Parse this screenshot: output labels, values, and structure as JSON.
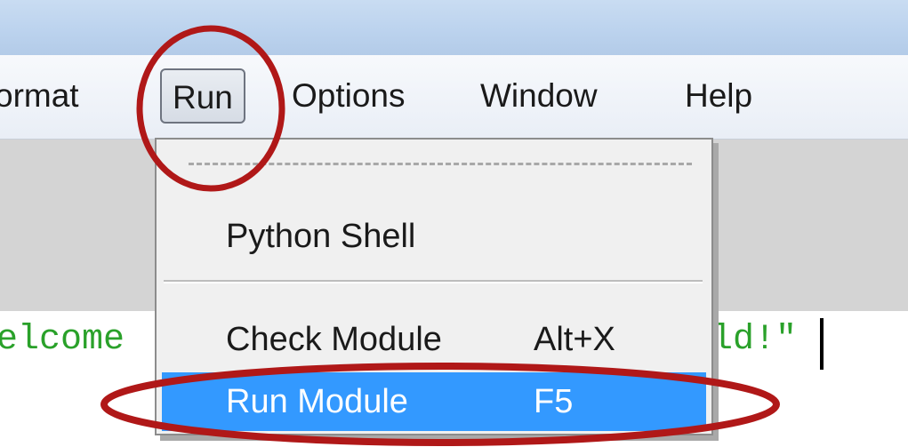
{
  "menu_bar": {
    "items": [
      {
        "label": "ormat"
      },
      {
        "label": "Run"
      },
      {
        "label": "Options"
      },
      {
        "label": "Window"
      },
      {
        "label": "Help"
      }
    ]
  },
  "editor": {
    "left_fragment": "elcome",
    "right_fragment": "ld!\""
  },
  "run_menu": {
    "items": [
      {
        "label": "Python Shell",
        "shortcut": ""
      },
      {
        "label": "Check Module",
        "shortcut": "Alt+X"
      },
      {
        "label": "Run Module",
        "shortcut": "F5"
      }
    ]
  },
  "colors": {
    "highlight": "#3399ff",
    "annotation": "#b01818",
    "code_string": "#2aa12a"
  }
}
